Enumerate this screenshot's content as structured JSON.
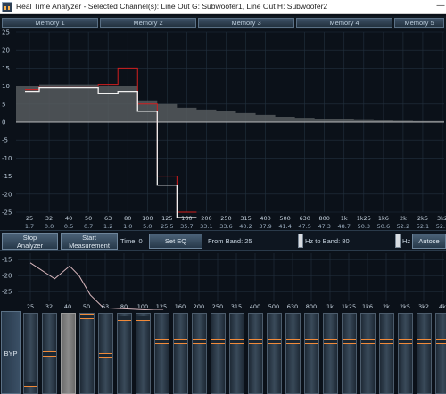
{
  "window": {
    "title": "Real Time Analyzer - Selected Channel(s): Line Out G: Subwoofer1, Line Out H: Subwoofer2",
    "minimize_glyph": "—"
  },
  "tabs": [
    "Memory 1",
    "Memory 2",
    "Memory 3",
    "Memory 4",
    "Memory 5"
  ],
  "colors": {
    "background": "#0b1119",
    "grid": "#23313f",
    "zero_line": "#e4e4e4",
    "measurement": "#f0f0f0",
    "target": "#d11f1f",
    "envelope": "#565a5e",
    "fader_handle": "#f08a3a"
  },
  "rta": {
    "y_ticks": [
      "25",
      "20",
      "15",
      "10",
      "5",
      "0",
      "-5",
      "-10",
      "-15",
      "-20",
      "-25"
    ],
    "bands": [
      "25",
      "32",
      "40",
      "50",
      "63",
      "80",
      "100",
      "125",
      "160",
      "200",
      "250",
      "315",
      "400",
      "500",
      "630",
      "800",
      "1k",
      "1k25",
      "1k6",
      "2k",
      "2k5",
      "3k2"
    ],
    "band_values": [
      "1.7",
      "0.0",
      "0.5",
      "0.7",
      "1.2",
      "1.0",
      "5.0",
      "25.5",
      "35.7",
      "33.1",
      "33.6",
      "40.2",
      "37.9",
      "41.4",
      "47.5",
      "47.3",
      "48.7",
      "50.3",
      "50.6",
      "52.2",
      "52.1",
      "52.1"
    ]
  },
  "chart_data": {
    "type": "line",
    "title": "",
    "xlabel": "",
    "ylabel": "",
    "ylim": [
      -25,
      25
    ],
    "x": [
      "25",
      "32",
      "40",
      "50",
      "63",
      "80",
      "100",
      "125",
      "160",
      "200",
      "250",
      "315",
      "400",
      "500",
      "630",
      "800",
      "1k",
      "1k25",
      "1k6",
      "2k",
      "2k5",
      "3k2"
    ],
    "series": [
      {
        "values": [
          8.5,
          9.5,
          9.5,
          9.5,
          8,
          8.5,
          3,
          -17.5,
          -27,
          -27,
          -27,
          -27,
          -27,
          -27,
          -27,
          -27,
          -27,
          -27,
          -27,
          -27,
          -27,
          -27
        ]
      },
      {
        "values": [
          9,
          10,
          10,
          10,
          10.5,
          15,
          5,
          -15,
          -25,
          -25,
          -25,
          -25,
          -25,
          -25,
          -25,
          -25,
          -25,
          -25,
          -25,
          -25,
          -25,
          -25
        ]
      },
      {
        "values": [
          10,
          10.5,
          10.5,
          10.5,
          10,
          10,
          6,
          5,
          4,
          3.5,
          3,
          2.5,
          2,
          1.5,
          1.2,
          1,
          0.8,
          0.6,
          0.5,
          0.4,
          0.3,
          0.3
        ]
      }
    ],
    "grid": true
  },
  "controls": {
    "stop_analyzer": "Stop\nAnalyzer",
    "start_measurement": "Start\nMeasurement",
    "time_label": "Time: 0",
    "set_eq": "Set EQ",
    "from_band_label": "From Band: 25",
    "hz_to_band_label": "Hz  to Band: 80",
    "hz_label": "Hz",
    "autoset": "Autose"
  },
  "eq": {
    "y_ticks": [
      "-15",
      "-20",
      "-25"
    ],
    "bands": [
      "25",
      "32",
      "40",
      "50",
      "63",
      "80",
      "100",
      "125",
      "160",
      "200",
      "250",
      "315",
      "400",
      "500",
      "630",
      "800",
      "1k",
      "1k25",
      "1k6",
      "2k",
      "2k5",
      "3k2",
      "4k"
    ],
    "curve_db": [
      -16,
      -21,
      -17,
      -20,
      -26,
      -30,
      -35,
      -40
    ]
  },
  "faders": {
    "bypass_label": "BYP",
    "positions": [
      0.9,
      0.5,
      0.0,
      0.0,
      0.52,
      0.02,
      0.02,
      0.33,
      0.33,
      0.33,
      0.33,
      0.33,
      0.33,
      0.33,
      0.33,
      0.33,
      0.33,
      0.33,
      0.33,
      0.33,
      0.33,
      0.33,
      0.33
    ],
    "selected_index": 2
  }
}
